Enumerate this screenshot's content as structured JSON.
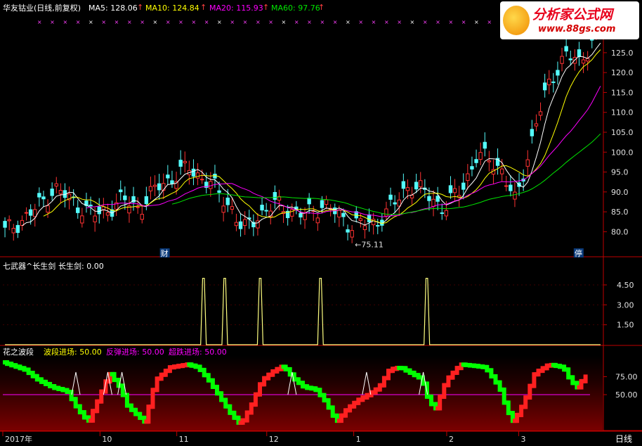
{
  "main_header": {
    "title": "华友钴业(日线,前复权)",
    "ma5_label": "MA5: 128.06",
    "ma10_label": "MA10: 124.84",
    "ma20_label": "MA20: 115.93",
    "ma60_label": "MA60: 97.76",
    "up_arrow": "↑"
  },
  "logo": {
    "title": "分析家公式网",
    "url": "www.88gs.com"
  },
  "indicator1_header": {
    "title": "七武器^长生剑",
    "value_label": "长生剑: 0.00"
  },
  "indicator2_header": {
    "title": "花之波段",
    "wave_label": "波段进场: 50.00",
    "rebound_label": "反弹进场: 50.00",
    "oversold_label": "超跌进场: 50.00"
  },
  "date_axis": {
    "labels": [
      "2017年",
      "10",
      "11",
      "12",
      "1",
      "2",
      "3"
    ],
    "period_button": "日线"
  },
  "colors": {
    "up": "#ff3232",
    "down": "#54fcfc",
    "ma5": "#ffffff",
    "ma10": "#ffff00",
    "ma20": "#ff00ff",
    "ma60": "#00e600",
    "signal": "#ffff80",
    "wave_up": "#ff2020",
    "wave_down": "#00ff00",
    "mid_line": "#ff00ff",
    "axis": "#c00000"
  },
  "chart_data": [
    {
      "type": "candlestick",
      "title": "华友钴业(日线,前复权)",
      "y_ticks": [
        80,
        85,
        90,
        95,
        100,
        105,
        110,
        115,
        120,
        125,
        130
      ],
      "ylim": [
        76,
        134
      ],
      "min_annotation": {
        "text": "←75.11",
        "value": 75.11
      },
      "event_labels": [
        "财",
        "停"
      ],
      "n_bars": 140
    },
    {
      "type": "line",
      "title": "七武器^长生剑",
      "y_ticks": [
        1.5,
        3.0,
        4.5
      ],
      "ylim": [
        0,
        5.4
      ],
      "spike_value": 5.0,
      "spike_days": [
        56,
        62,
        72,
        89,
        119
      ]
    },
    {
      "type": "line",
      "title": "花之波段",
      "y_ticks": [
        50.0,
        75.0
      ],
      "ylim": [
        0,
        100
      ],
      "midline": 50,
      "signal_days": [
        20,
        29,
        33,
        81,
        102,
        118
      ]
    }
  ]
}
